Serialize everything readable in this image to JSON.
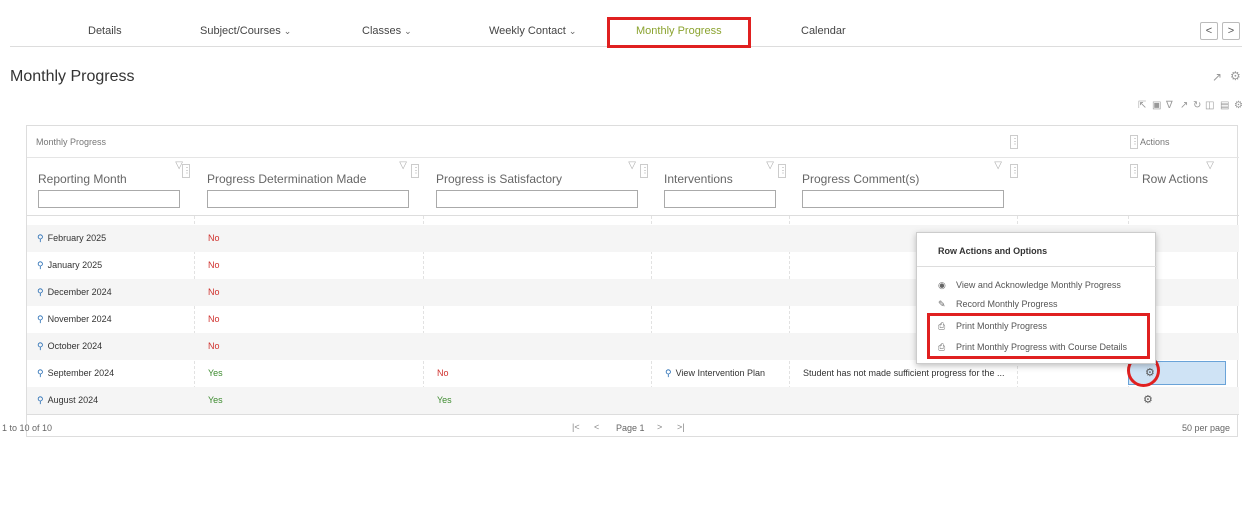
{
  "nav": {
    "tabs": [
      {
        "label": "Details",
        "has_dropdown": false
      },
      {
        "label": "Subject/Courses",
        "has_dropdown": true
      },
      {
        "label": "Classes",
        "has_dropdown": true
      },
      {
        "label": "Weekly Contact",
        "has_dropdown": true
      },
      {
        "label": "Monthly Progress",
        "has_dropdown": false,
        "active": true
      },
      {
        "label": "Calendar",
        "has_dropdown": false
      }
    ],
    "prev": "<",
    "next": ">",
    "active_color": "#8ba32f"
  },
  "page": {
    "title": "Monthly Progress"
  },
  "grid": {
    "group_label": "Monthly Progress",
    "actions_group_label": "Actions",
    "columns": [
      "Reporting Month",
      "Progress Determination Made",
      "Progress is Satisfactory",
      "Interventions",
      "Progress Comment(s)",
      "Row Actions"
    ],
    "rows": [
      {
        "month": "February 2025",
        "determination": "No",
        "satisfactory": "",
        "interventions": "",
        "comment": ""
      },
      {
        "month": "January 2025",
        "determination": "No",
        "satisfactory": "",
        "interventions": "",
        "comment": ""
      },
      {
        "month": "December 2024",
        "determination": "No",
        "satisfactory": "",
        "interventions": "",
        "comment": ""
      },
      {
        "month": "November 2024",
        "determination": "No",
        "satisfactory": "",
        "interventions": "",
        "comment": ""
      },
      {
        "month": "October 2024",
        "determination": "No",
        "satisfactory": "",
        "interventions": "",
        "comment": ""
      },
      {
        "month": "September 2024",
        "determination": "Yes",
        "satisfactory": "No",
        "interventions": "View Intervention Plan",
        "comment": "Student has not made sufficient progress for the ..."
      },
      {
        "month": "August 2024",
        "determination": "Yes",
        "satisfactory": "Yes",
        "interventions": "",
        "comment": ""
      }
    ],
    "footer": {
      "range": "1 to 10 of 10",
      "first": "|<",
      "prev": "<",
      "page": "Page 1",
      "next": ">",
      "last": ">|",
      "per_page": "50 per page"
    }
  },
  "popup": {
    "title": "Row Actions and Options",
    "items": [
      {
        "label": "View and Acknowledge Monthly Progress",
        "icon": "eye-icon"
      },
      {
        "label": "Record Monthly Progress",
        "icon": "pencil-icon"
      },
      {
        "label": "Print Monthly Progress",
        "icon": "printer-icon"
      },
      {
        "label": "Print Monthly Progress with Course Details",
        "icon": "printer-icon"
      }
    ]
  },
  "colors": {
    "no": "#d0312d",
    "yes": "#3d8b2f",
    "link": "#2a6fb5",
    "highlight": "#e02020"
  }
}
